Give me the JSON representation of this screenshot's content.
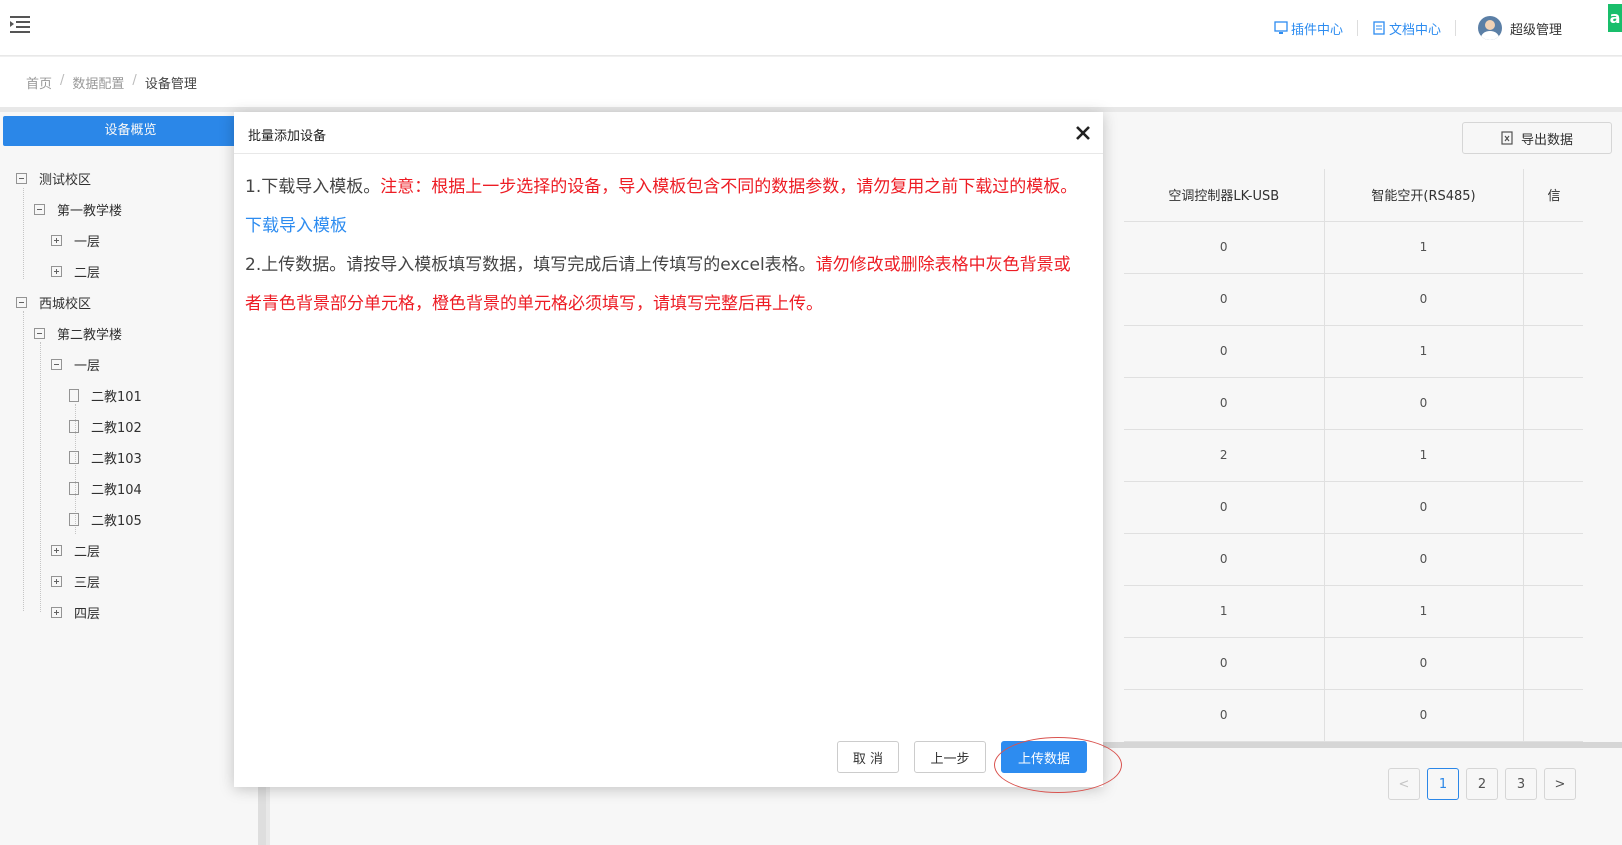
{
  "header": {
    "plugin_center": "插件中心",
    "doc_center": "文档中心",
    "user_name": "超级管理",
    "corner_badge": "a"
  },
  "breadcrumb": [
    "首页",
    "数据配置",
    "设备管理"
  ],
  "sidebar": {
    "overview_button": "设备概览",
    "tree": [
      {
        "label": "测试校区"
      },
      {
        "label": "第一教学楼"
      },
      {
        "label": "一层"
      },
      {
        "label": "二层"
      },
      {
        "label": "西城校区"
      },
      {
        "label": "第二教学楼"
      },
      {
        "label": "一层"
      },
      {
        "label": "二教101"
      },
      {
        "label": "二教102"
      },
      {
        "label": "二教103"
      },
      {
        "label": "二教104"
      },
      {
        "label": "二教105"
      },
      {
        "label": "二层"
      },
      {
        "label": "三层"
      },
      {
        "label": "四层"
      }
    ]
  },
  "main": {
    "export_button": "导出数据",
    "table": {
      "headers": [
        "空调控制器LK-USB",
        "智能空开(RS485)",
        "信"
      ],
      "rows": [
        [
          "0",
          "1"
        ],
        [
          "0",
          "0"
        ],
        [
          "0",
          "1"
        ],
        [
          "0",
          "0"
        ],
        [
          "2",
          "1"
        ],
        [
          "0",
          "0"
        ],
        [
          "0",
          "0"
        ],
        [
          "1",
          "1"
        ],
        [
          "0",
          "0"
        ],
        [
          "0",
          "0"
        ]
      ]
    },
    "pagination": {
      "prev": "<",
      "pages": [
        "1",
        "2",
        "3"
      ],
      "next": ">",
      "current": "1"
    }
  },
  "modal": {
    "title": "批量添加设备",
    "step1_prefix": "1.下载导入模板。",
    "step1_warning": "注意：根据上一步选择的设备，导入模板包含不同的数据参数，请勿复用之前下载过的模板。",
    "download_link": "下载导入模板",
    "step2_prefix": "2.上传数据。请按导入模板填写数据，填写完成后请上传填写的excel表格。",
    "step2_warning": "请勿修改或删除表格中灰色背景或者青色背景部分单元格，橙色背景的单元格必须填写，请填写完整后再上传。",
    "cancel_button": "取 消",
    "prev_button": "上一步",
    "upload_button": "上传数据"
  },
  "colors": {
    "primary": "#2d8cf0",
    "warning_text": "#ed1c24",
    "highlight_ring": "#d9534f",
    "badge": "#19be6b"
  }
}
